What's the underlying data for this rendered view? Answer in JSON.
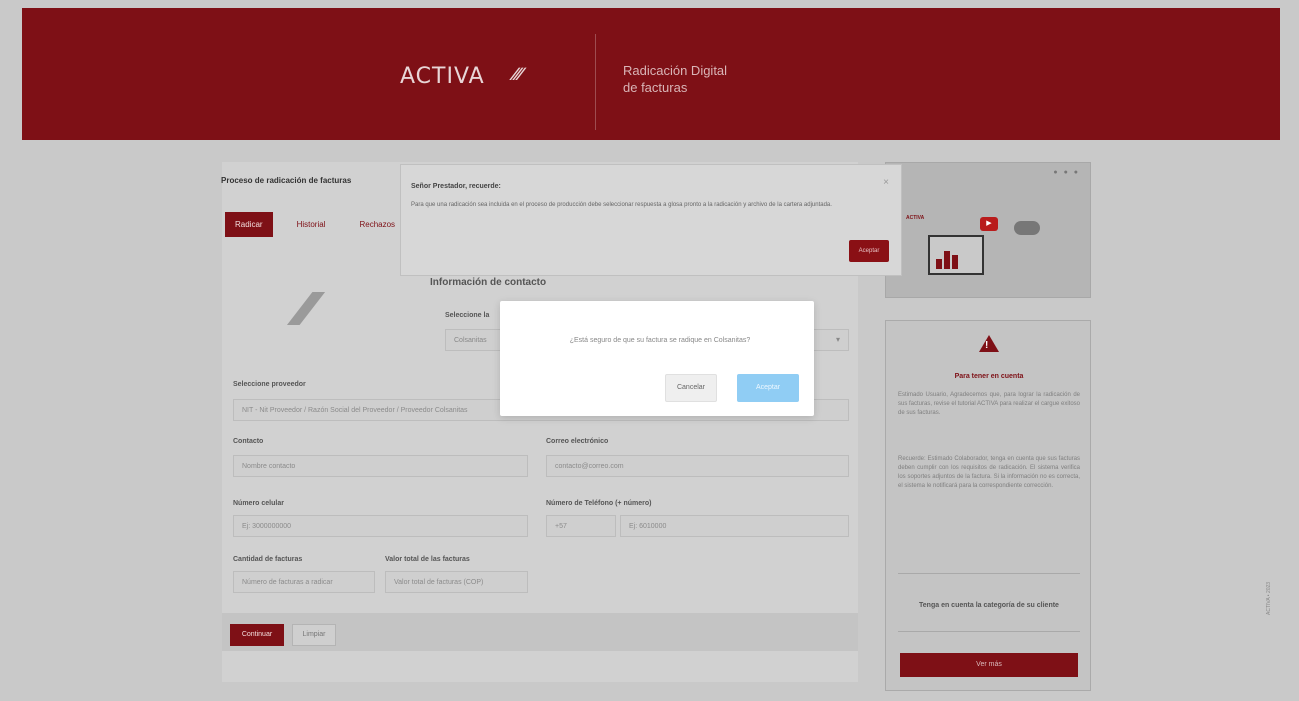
{
  "header": {
    "logo": "ACTIVA",
    "logo_mark": "∕∕∕",
    "subtitle_line1": "Radicación Digital",
    "subtitle_line2": "de facturas"
  },
  "breadcrumb": "Proceso de radicación de facturas",
  "tabs": [
    {
      "label": "Radicar",
      "active": true
    },
    {
      "label": "Historial",
      "active": false
    },
    {
      "label": "Rechazos",
      "active": false
    }
  ],
  "watermark": "∕∕∕",
  "form": {
    "section_title": "Información de contacto",
    "seleccione_label": "Seleccione la",
    "select_value": "Colsanitas",
    "proveedor_label": "Seleccione proveedor",
    "proveedor_value": "NIT - Nit Proveedor / Razón Social del Proveedor / Proveedor Colsanitas",
    "contacto_label": "Contacto",
    "contacto_placeholder": "Nombre contacto",
    "correo_label": "Correo electrónico",
    "correo_placeholder": "contacto@correo.com",
    "numero_label": "Número celular",
    "numero_placeholder": "Ej: 3000000000",
    "telefono_label": "Número de Teléfono (+ número)",
    "telefono_prefix": "+57",
    "telefono_placeholder": "Ej: 6010000",
    "cantidad_label": "Cantidad de facturas",
    "cantidad_placeholder": "Número de facturas a radicar",
    "valor_label": "Valor total de las facturas",
    "valor_placeholder": "Valor total de facturas (COP)"
  },
  "actions": {
    "continuar": "Continuar",
    "limpiar": "Limpiar"
  },
  "video": {
    "label": "ACTIVA",
    "play_icon": "play-icon"
  },
  "side_panel": {
    "title": "Para tener en cuenta",
    "paragraph1": "Estimado Usuario, Agradecemos que, para lograr la radicación de sus facturas, revise el tutorial ACTIVA para realizar el cargue exitoso de sus facturas.",
    "paragraph2": "Recuerde: Estimado Colaborador, tenga en cuenta que sus facturas deben cumplir con los requisitos de radicación. El sistema verifica los soportes adjuntos de la factura. Si la información no es correcta, el sistema le notificará para la correspondiente corrección.",
    "category": "Tenga en cuenta la categoría de su cliente",
    "button": "Ver más"
  },
  "side_ticker": "ACTIVA • 2023",
  "notice": {
    "title": "Señor Prestador, recuerde:",
    "body": "Para que una radicación sea incluida en el proceso de producción debe seleccionar respuesta a glosa pronto a la radicación y archivo de la cartera adjuntada.",
    "close": "×",
    "button": "Aceptar"
  },
  "modal": {
    "message": "¿Está seguro de que su factura se radique en Colsanitas?",
    "cancel": "Cancelar",
    "accept": "Aceptar"
  },
  "colors": {
    "brand": "#7e1016",
    "accept_button": "#90cdf4"
  }
}
